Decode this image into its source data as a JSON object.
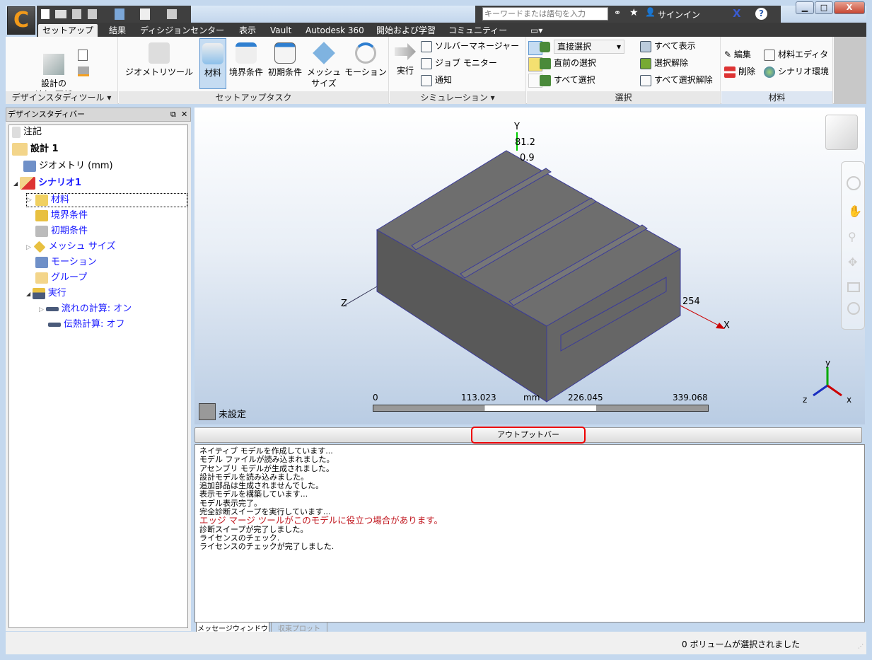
{
  "app": {
    "logo": "C"
  },
  "search": {
    "placeholder": "キーワードまたは語句を入力",
    "sign_in": "サインイン",
    "help": "?"
  },
  "tabs": [
    "セットアップ",
    "結果",
    "ディシジョンセンター",
    "表示",
    "Vault",
    "Autodesk 360",
    "開始および学習",
    "コミュニティー"
  ],
  "ribbon": {
    "design_tools": {
      "add_update": "設計の\n追加/更新",
      "label": "デザインスタディツール ▾"
    },
    "setup_tasks": {
      "geometry_tools": "ジオメトリツール",
      "material": "材料",
      "boundary": "境界条件",
      "initial": "初期条件",
      "mesh_line1": "メッシュ",
      "mesh_line2": "サイズ",
      "motion": "モーション",
      "label": "セットアップタスク"
    },
    "simulation": {
      "run": "実行",
      "solver_manager": "ソルバーマネージャー",
      "job_monitor": "ジョブ モニター",
      "notify": "通知",
      "label": "シミュレーション ▾"
    },
    "selection": {
      "mode": "直接選択",
      "previous": "直前の選択",
      "select_all": "すべて選択",
      "show_all": "すべて表示",
      "deselect": "選択解除",
      "deselect_all": "すべて選択解除",
      "label": "選択"
    },
    "materials": {
      "edit": "編集",
      "delete": "削除",
      "editor": "材料エディタ",
      "scenario_env": "シナリオ環境",
      "label": "材料"
    }
  },
  "sidebar": {
    "title": "デザインスタディバー",
    "tree": [
      {
        "label": "注記"
      },
      {
        "label": "設計 1"
      },
      {
        "label": "ジオメトリ (mm)"
      },
      {
        "label": "シナリオ1"
      },
      {
        "label": "材料"
      },
      {
        "label": "境界条件"
      },
      {
        "label": "初期条件"
      },
      {
        "label": "メッシュ サイズ"
      },
      {
        "label": "モーション"
      },
      {
        "label": "グループ"
      },
      {
        "label": "実行"
      },
      {
        "label": "流れの計算: オン"
      },
      {
        "label": "伝熱計算: オフ"
      }
    ]
  },
  "viewport": {
    "axis_y": "Y",
    "axis_x": "X",
    "axis_z": "Z",
    "dim_y1": "81.2",
    "dim_y2": "0.9",
    "dim_x": "254",
    "scale": {
      "t0": "0",
      "t1": "113.023",
      "unit": "mm",
      "t2": "226.045",
      "t3": "339.068"
    },
    "legend": "未設定",
    "triad": {
      "y": "y",
      "x": "x",
      "z": "z"
    },
    "colors": {
      "body": "#6b6b6b",
      "edges": "#3b3b9a"
    }
  },
  "output": {
    "bar_label": "アウトプットバー",
    "messages": [
      {
        "text": "ネイティブ モデルを作成しています...",
        "color": "#000000"
      },
      {
        "text": "モデル ファイルが読み込まれました。",
        "color": "#000000"
      },
      {
        "text": "アセンブリ モデルが生成されました。",
        "color": "#000000"
      },
      {
        "text": "設計モデルを読み込みました。",
        "color": "#000000"
      },
      {
        "text": "追加部品は生成されませんでした。",
        "color": "#000000"
      },
      {
        "text": "表示モデルを構築しています...",
        "color": "#000000"
      },
      {
        "text": "モデル表示完了。",
        "color": "#000000"
      },
      {
        "text": "完全診断スイープを実行しています...",
        "color": "#000000"
      },
      {
        "text": "エッジ マージ ツールがこのモデルに役立つ場合があります。",
        "color": "#c0141c"
      },
      {
        "text": "診断スイープが完了しました。",
        "color": "#000000"
      },
      {
        "text": "ライセンスのチェック.",
        "color": "#000000"
      },
      {
        "text": "ライセンスのチェックが完了しました.",
        "color": "#000000"
      }
    ],
    "tabs": [
      "メッセージウィンドウ",
      "収束プロット"
    ]
  },
  "status": {
    "text": "0 ボリュームが選択されました"
  }
}
